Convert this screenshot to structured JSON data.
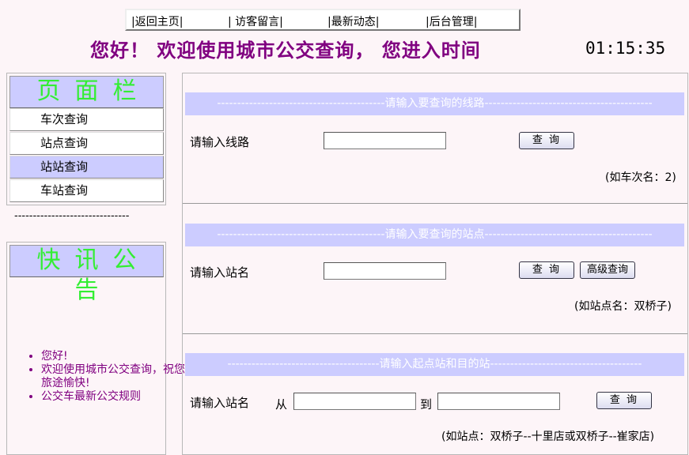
{
  "nav": {
    "home": "|返回主页|",
    "guestbook": "| 访客留言|",
    "news": "|最新动态|",
    "admin": "|后台管理|"
  },
  "header": {
    "welcome": "您好！ 欢迎使用城市公交查询， 您进入时间",
    "time": "01:15:35"
  },
  "sidebar": {
    "title": "页面栏",
    "items": [
      {
        "label": "车次查询"
      },
      {
        "label": "站点查询"
      },
      {
        "label": "站站查询"
      },
      {
        "label": "车站查询"
      }
    ],
    "divider": "-------------------------------"
  },
  "announcements": {
    "title": "快讯公告",
    "items": [
      "您好!",
      "欢迎使用城市公交查询，祝您旅途愉快!",
      "公交车最新公交规则"
    ]
  },
  "route_query": {
    "heading": "请输入要查询的线路",
    "label": "请输入线路",
    "input_value": "",
    "button": "查 询",
    "hint": "(如车次名：2)"
  },
  "stop_query": {
    "heading": "请输入要查询的站点",
    "label": "请输入站名",
    "input_value": "",
    "button": "查 询",
    "advanced_button": "高级查询",
    "hint": "(如站点名：双桥子)"
  },
  "transfer_query": {
    "heading": "请输入起点站和目的站",
    "label": "请输入站名",
    "from_label": "从",
    "to_label": "到",
    "from_value": "",
    "to_value": "",
    "button": "查 询",
    "hint": "(如站点：双桥子--十里店或双桥子--崔家店)"
  },
  "colors": {
    "accent_purple": "#800080",
    "panel_lavender": "#ccccff",
    "title_green": "#33ee33",
    "page_bg": "#fdf5f8"
  }
}
